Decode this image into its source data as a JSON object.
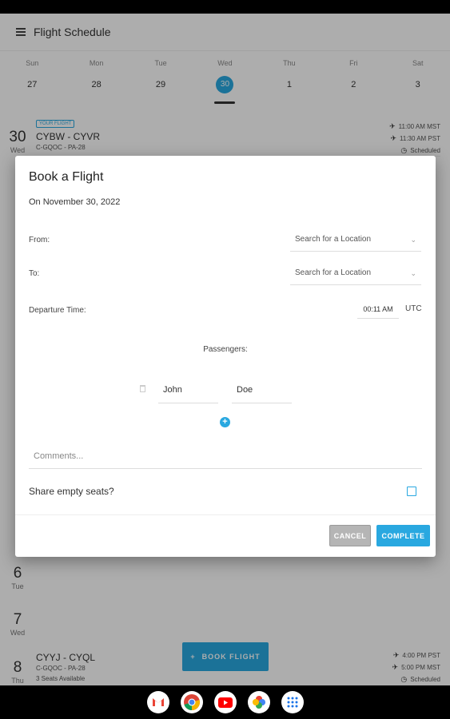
{
  "app": {
    "title": "Flight Schedule"
  },
  "week": [
    {
      "name": "Sun",
      "num": "27"
    },
    {
      "name": "Mon",
      "num": "28"
    },
    {
      "name": "Tue",
      "num": "29"
    },
    {
      "name": "Wed",
      "num": "30",
      "selected": true
    },
    {
      "name": "Thu",
      "num": "1"
    },
    {
      "name": "Fri",
      "num": "2"
    },
    {
      "name": "Sat",
      "num": "3"
    }
  ],
  "schedule": {
    "first": {
      "day_num": "30",
      "day_name": "Wed",
      "badge": "YOUR FLIGHT",
      "route": "CYBW - CYVR",
      "aircraft": "C-GQOC - PA-28",
      "depart": "11:00 AM MST",
      "arrive": "11:30 AM PST",
      "status": "Scheduled"
    },
    "tue": {
      "day_num": "6",
      "day_name": "Tue"
    },
    "wed": {
      "day_num": "7",
      "day_name": "Wed"
    },
    "last": {
      "day_num": "8",
      "day_name": "Thu",
      "route": "CYYJ - CYQL",
      "aircraft": "C-GQOC - PA-28",
      "seats": "3 Seats Available",
      "depart": "4:00 PM PST",
      "arrive": "5:00 PM MST",
      "status": "Scheduled"
    }
  },
  "fab": {
    "label": "BOOK FLIGHT"
  },
  "dialog": {
    "title": "Book a Flight",
    "date_line": "On November 30, 2022",
    "from_label": "From:",
    "from_value": "Search for a Location",
    "to_label": "To:",
    "to_value": "Search for a Location",
    "departure_label": "Departure Time:",
    "departure_value": "00:11 AM",
    "timezone": "UTC",
    "passengers_label": "Passengers:",
    "first_name": "John",
    "last_name": "Doe",
    "comments_placeholder": "Comments...",
    "share_label": "Share empty seats?",
    "cancel": "CANCEL",
    "complete": "COMPLETE"
  },
  "nav_apps": [
    "Gmail",
    "Chrome",
    "YouTube",
    "Photos",
    "App Launcher"
  ],
  "colors": {
    "accent": "#29a8e0"
  }
}
